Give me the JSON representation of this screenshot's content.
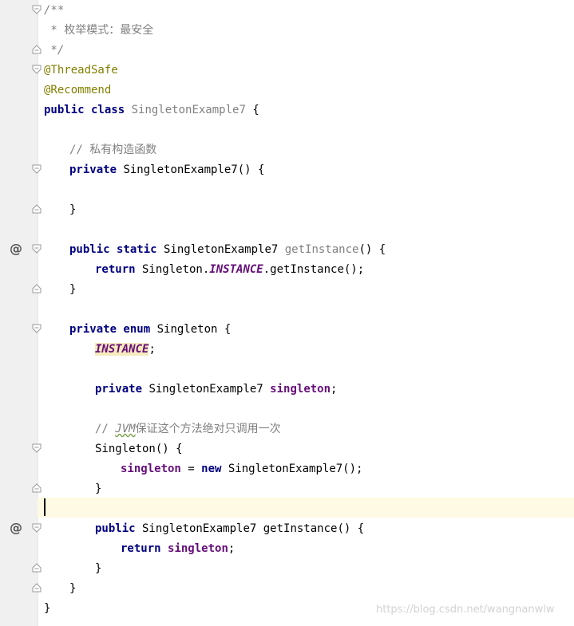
{
  "editor": {
    "comment_open": "/**",
    "comment_body": " * 枚举模式：最安全",
    "comment_close": " */",
    "annotation_threadsafe": "@ThreadSafe",
    "annotation_recommend": "@Recommend",
    "class_kw": "public class",
    "class_name": "SingletonExample7",
    "open_brace": " {",
    "comment_private_ctor": "// 私有构造函数",
    "private_kw": "private",
    "ctor_sig": " SingletonExample7() {",
    "close_brace": "}",
    "public_static_kw": "public static",
    "return_type": " SingletonExample7 ",
    "method_getinstance_unused": "getInstance",
    "method_params_open": "() {",
    "return_kw": "return",
    "singleton_ref": " Singleton.",
    "instance_const": "INSTANCE",
    "getinstance_call": ".getInstance();",
    "private_enum_kw": "private enum",
    "enum_name": " Singleton {",
    "semicolon": ";",
    "field_type": " SingletonExample7 ",
    "field_name": "singleton",
    "comment_jvm_prefix": "// ",
    "comment_jvm_word": "JVM",
    "comment_jvm_rest": "保证这个方法绝对只调用一次",
    "enum_ctor_sig": "Singleton() {",
    "assign_eq": " = ",
    "new_kw": "new",
    "new_expr": " SingletonExample7();",
    "public_kw": "public",
    "public_method_sig": " SingletonExample7 getInstance() {"
  },
  "gutter": {
    "override_marker": "@"
  },
  "watermark": "https://blog.csdn.net/wangnanwlw",
  "colors": {
    "keyword": "#000080",
    "comment": "#808080",
    "annotation": "#808000",
    "field": "#660e7a",
    "current_line": "#fffae3",
    "gutter_bg": "#f0f0f0"
  }
}
